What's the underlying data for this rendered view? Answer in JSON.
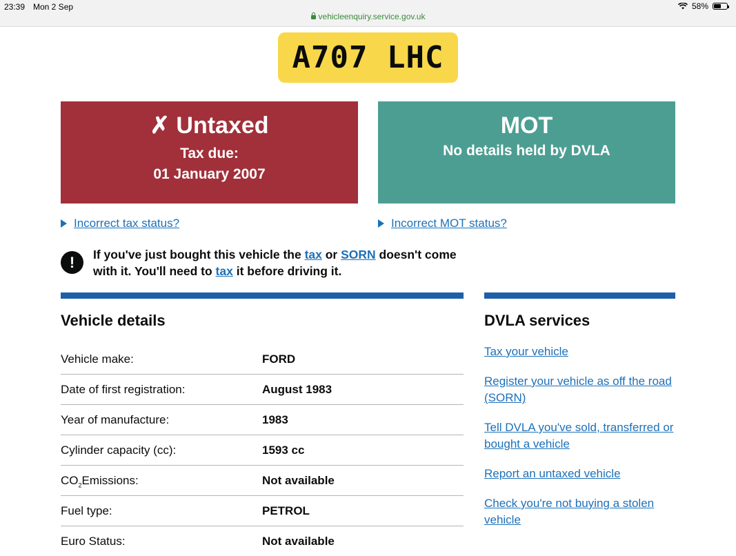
{
  "status_bar": {
    "time": "23:39",
    "date": "Mon 2 Sep",
    "battery": "58%"
  },
  "browser": {
    "url": "vehicleenquiry.service.gov.uk"
  },
  "plate": "A707 LHC",
  "tax_box": {
    "title": "✗ Untaxed",
    "line1": "Tax due:",
    "line2": "01 January 2007",
    "color": "#a1303a"
  },
  "mot_box": {
    "title": "MOT",
    "line1": "No details held by DVLA",
    "color": "#4d9e92"
  },
  "links": {
    "tax_status": "Incorrect tax status?",
    "mot_status": "Incorrect MOT status?"
  },
  "warning": {
    "part1": "If you've just bought this vehicle the ",
    "link_tax": "tax",
    "part2": " or ",
    "link_sorn": "SORN",
    "part3": " doesn't come with it. You'll need to ",
    "link_tax2": "tax",
    "part4": " it before driving it."
  },
  "vehicle_details": {
    "heading": "Vehicle details",
    "rows": [
      {
        "label": "Vehicle make:",
        "value": "FORD"
      },
      {
        "label": "Date of first registration:",
        "value": "August 1983"
      },
      {
        "label": "Year of manufacture:",
        "value": "1983"
      },
      {
        "label": "Cylinder capacity (cc):",
        "value": "1593 cc"
      },
      {
        "label_pre": "CO",
        "label_sub": "2",
        "label_post": "Emissions:",
        "value": "Not available"
      },
      {
        "label": "Fuel type:",
        "value": "PETROL"
      },
      {
        "label": "Euro Status:",
        "value": "Not available"
      }
    ]
  },
  "services": {
    "heading": "DVLA services",
    "links": [
      "Tax your vehicle",
      "Register your vehicle as off the road (SORN)",
      "Tell DVLA you've sold, transferred or bought a vehicle",
      "Report an untaxed vehicle",
      "Check you're not buying a stolen vehicle"
    ]
  },
  "colors": {
    "link": "#1d70b8",
    "plate": "#f8d84a",
    "rule": "#1d5fa8"
  }
}
